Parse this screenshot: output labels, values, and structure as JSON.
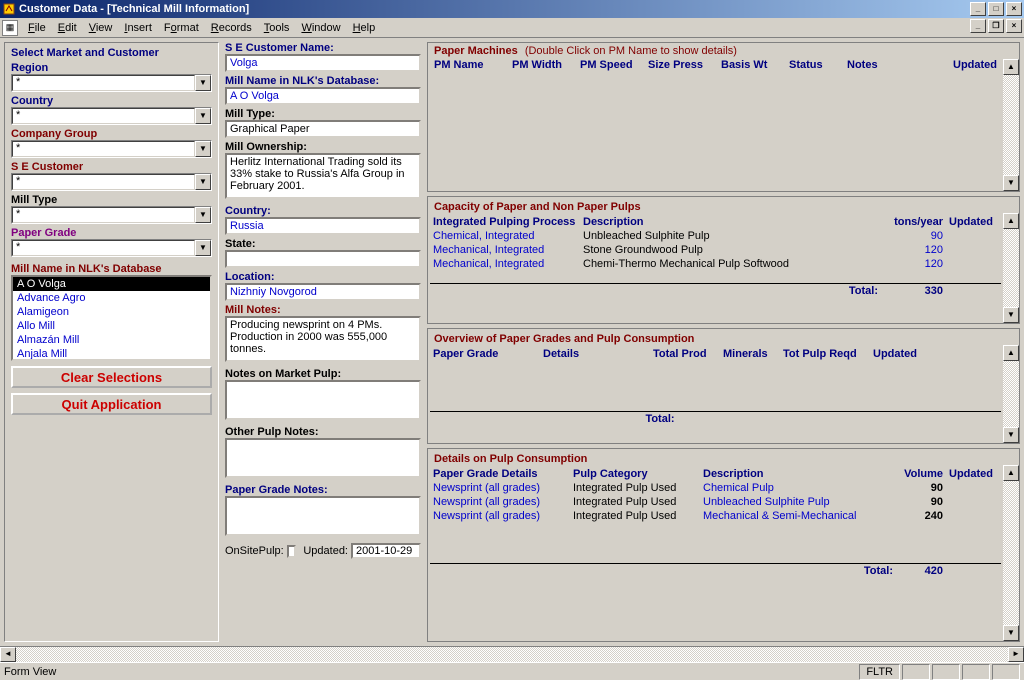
{
  "window": {
    "title": "Customer Data - [Technical Mill Information]"
  },
  "menus": [
    "File",
    "Edit",
    "View",
    "Insert",
    "Format",
    "Records",
    "Tools",
    "Window",
    "Help"
  ],
  "col1": {
    "group_title": "Select Market and Customer",
    "region_label": "Region",
    "region_value": "*",
    "country_label": "Country",
    "country_value": "*",
    "company_group_label": "Company Group",
    "company_group_value": "*",
    "se_customer_label": "S E Customer",
    "se_customer_value": "*",
    "mill_type_label": "Mill Type",
    "mill_type_value": "*",
    "paper_grade_label": "Paper Grade",
    "paper_grade_value": "*",
    "mill_list_label": "Mill Name in NLK's Database",
    "mill_list": [
      "A O Volga",
      "Advance Agro",
      "Alamigeon",
      "Allo Mill",
      "Almazán Mill",
      "Anjala Mill"
    ],
    "clear_btn": "Clear Selections",
    "quit_btn": "Quit Application"
  },
  "col2": {
    "se_name_label": "S E Customer Name:",
    "se_name_value": "Volga",
    "nlk_name_label": "Mill Name in NLK's Database:",
    "nlk_name_value": "A O Volga",
    "mill_type_label": "Mill Type:",
    "mill_type_value": "Graphical Paper",
    "ownership_label": "Mill Ownership:",
    "ownership_value": "Herlitz International Trading sold its 33% stake to Russia's Alfa Group in February 2001.",
    "country_label": "Country:",
    "country_value": "Russia",
    "state_label": "State:",
    "state_value": "",
    "location_label": "Location:",
    "location_value": "Nizhniy Novgorod",
    "mill_notes_label": "Mill Notes:",
    "mill_notes_value": "Producing newsprint on 4 PMs.  Production in 2000 was 555,000 tonnes.",
    "market_pulp_label": "Notes on Market Pulp:",
    "other_pulp_label": "Other Pulp Notes:",
    "paper_grade_notes_label": "Paper Grade  Notes:",
    "onsite_label": "OnSitePulp:",
    "updated_label": "Updated:",
    "updated_value": "2001-10-29"
  },
  "panes": {
    "pm_title": "Paper Machines",
    "pm_subtitle": "(Double Click on PM Name to show details)",
    "pm_cols": [
      "PM Name",
      "PM Width",
      "PM Speed",
      "Size Press",
      "Basis Wt",
      "Status",
      "Notes",
      "Updated"
    ],
    "cap_title": "Capacity of Paper and Non Paper Pulps",
    "cap_cols": [
      "Integrated Pulping Process",
      "Description",
      "tons/year",
      "Updated"
    ],
    "cap_rows": [
      {
        "proc": "Chemical, Integrated",
        "desc": "Unbleached Sulphite Pulp",
        "tons": "90"
      },
      {
        "proc": "Mechanical, Integrated",
        "desc": "Stone Groundwood Pulp",
        "tons": "120"
      },
      {
        "proc": "Mechanical, Integrated",
        "desc": "Chemi-Thermo Mechanical Pulp Softwood",
        "tons": "120"
      }
    ],
    "cap_total_label": "Total:",
    "cap_total": "330",
    "ov_title": "Overview of Paper Grades and Pulp Consumption",
    "ov_cols": [
      "Paper Grade",
      "Details",
      "Total Prod",
      "Minerals",
      "Tot Pulp Reqd",
      "Updated"
    ],
    "ov_total_label": "Total:",
    "det_title": "Details on Pulp Consumption",
    "det_cols": [
      "Paper Grade Details",
      "Pulp Category",
      "Description",
      "Volume",
      "Updated"
    ],
    "det_rows": [
      {
        "pg": "Newsprint (all grades)",
        "cat": "Integrated Pulp Used",
        "desc": "Chemical Pulp",
        "vol": "90"
      },
      {
        "pg": "Newsprint (all grades)",
        "cat": "Integrated Pulp Used",
        "desc": "Unbleached Sulphite Pulp",
        "vol": "90"
      },
      {
        "pg": "Newsprint (all grades)",
        "cat": "Integrated Pulp Used",
        "desc": "Mechanical & Semi-Mechanical",
        "vol": "240"
      }
    ],
    "det_total_label": "Total:",
    "det_total": "420"
  },
  "statusbar": {
    "mode": "Form View",
    "fltr": "FLTR"
  }
}
